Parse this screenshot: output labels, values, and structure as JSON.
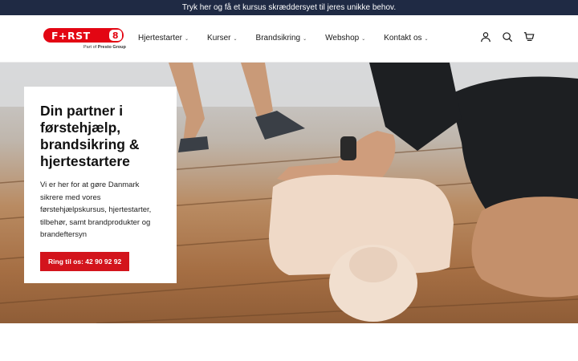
{
  "announcement": {
    "text": "Tryk her og få et kursus skræddersyet til jeres unikke behov."
  },
  "logo": {
    "wordmark": "F+RST",
    "digit": "8",
    "tagline_prefix": "Part of",
    "tagline_brand": "Presto Group"
  },
  "nav": {
    "items": [
      {
        "label": "Hjertestarter"
      },
      {
        "label": "Kurser"
      },
      {
        "label": "Brandsikring"
      },
      {
        "label": "Webshop"
      },
      {
        "label": "Kontakt os"
      }
    ]
  },
  "header_icons": [
    "account-icon",
    "search-icon",
    "cart-icon"
  ],
  "hero": {
    "title": "Din partner i førstehjælp, brandsikring & hjertestartere",
    "text": "Vi er her for at gøre Danmark sikrere med vores førstehjælpskursus, hjertestarter, tilbehør, samt brandprodukter og brandeftersyn",
    "cta_label": "Ring til os: 42 90 92 92"
  },
  "colors": {
    "announcement_bg": "#1f2a44",
    "brand_red": "#e30613",
    "cta_red": "#d3141c"
  }
}
